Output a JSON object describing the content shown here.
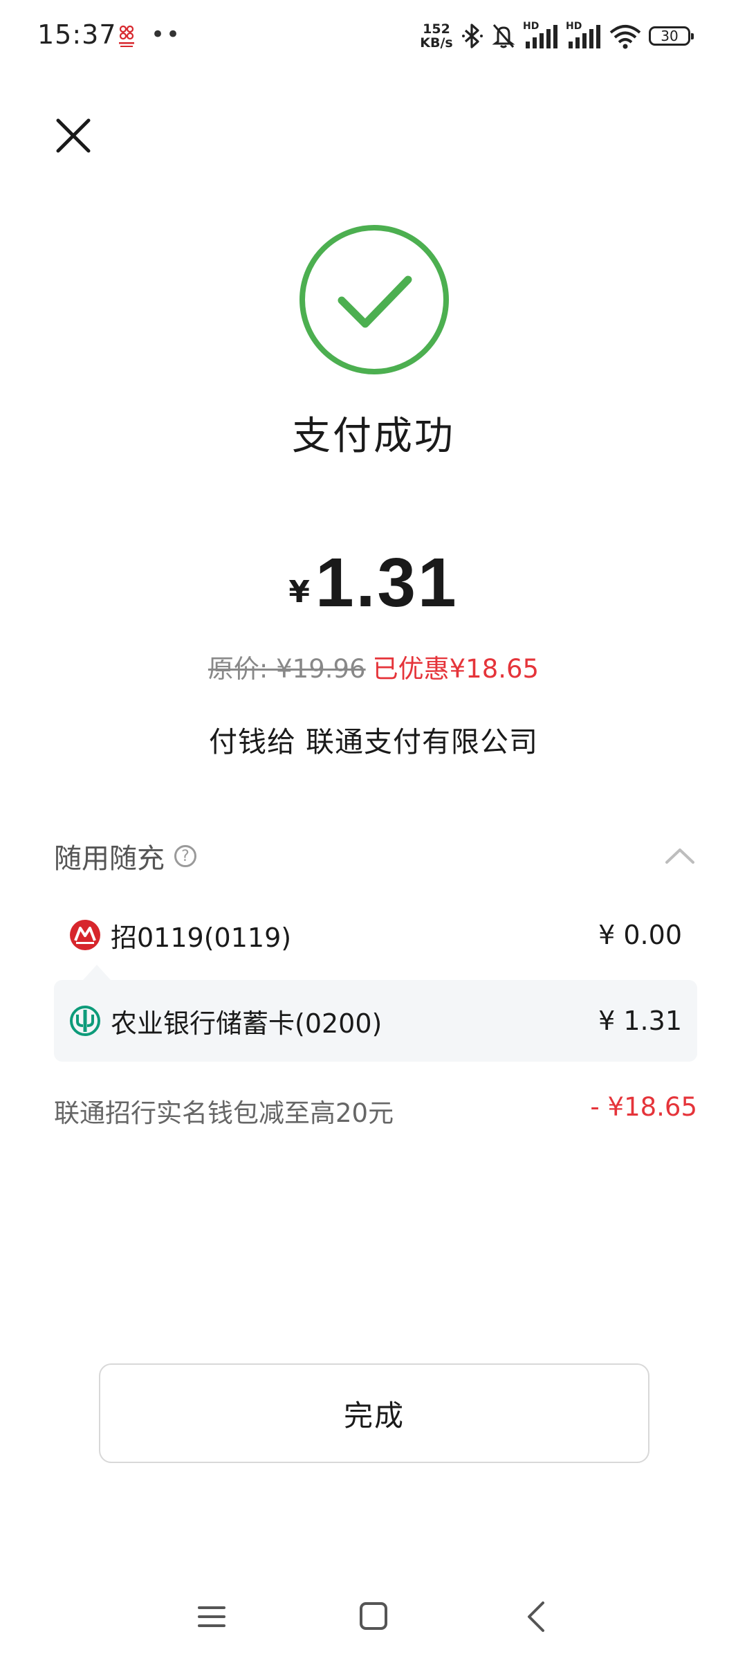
{
  "status_bar": {
    "time": "15:37",
    "dots": "••",
    "net_speed_value": "152",
    "net_speed_unit": "KB/s",
    "hd_label": "HD",
    "battery": "30",
    "icons": [
      "unicom-logo",
      "bluetooth-icon",
      "mute-bell-icon",
      "signal-hd-1-icon",
      "signal-hd-2-icon",
      "wifi-icon",
      "battery-icon"
    ]
  },
  "header": {
    "close_icon": "close-icon"
  },
  "result": {
    "icon": "check-circle-icon",
    "title": "支付成功"
  },
  "payment": {
    "currency_symbol": "¥",
    "amount": "1.31",
    "original_price": "原价: ¥19.96",
    "discount": "已优惠¥18.65",
    "payee": "付钱给 联通支付有限公司"
  },
  "section": {
    "title": "随用随充",
    "help_icon": "?",
    "collapse_icon": "chevron-up-icon",
    "rows": [
      {
        "icon": "cmb-bank-icon",
        "label": "招0119(0119)",
        "amount": "¥ 0.00"
      },
      {
        "icon": "abc-bank-icon",
        "label": "农业银行储蓄卡(0200)",
        "amount": "¥ 1.31"
      }
    ]
  },
  "promo": {
    "label": "联通招行实名钱包减至高20元",
    "amount": "- ¥18.65"
  },
  "actions": {
    "done_label": "完成"
  },
  "nav_bar": {
    "icons": [
      "menu-icon",
      "home-icon",
      "back-icon"
    ]
  },
  "colors": {
    "success_green": "#4caf50",
    "discount_red": "#e5343a",
    "cmb_red": "#d7262c",
    "abc_green": "#0d9b7a"
  }
}
